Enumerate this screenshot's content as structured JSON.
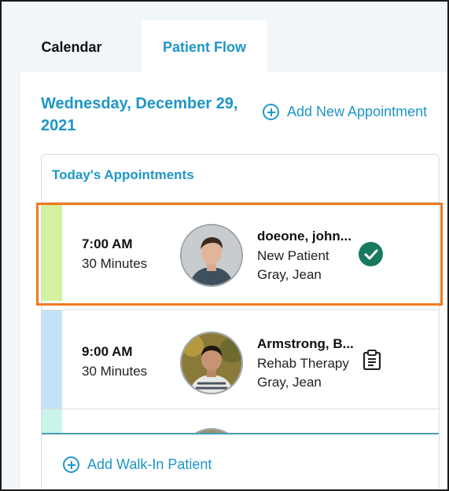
{
  "tabs": [
    {
      "label": "Calendar"
    },
    {
      "label": "Patient Flow",
      "active": true
    }
  ],
  "date_title": "Wednesday, December 29, 2021",
  "add_appointment_label": "Add New Appointment",
  "card_title": "Today's Appointments",
  "appointments": [
    {
      "time": "7:00 AM",
      "duration": "30 Minutes",
      "patient_name": "doeone, john...",
      "visit_type": "New Patient",
      "provider": "Gray, Jean",
      "status_icon": "check-circle-icon",
      "stripe_color": "#d4f0a0",
      "highlighted": true
    },
    {
      "time": "9:00 AM",
      "duration": "30 Minutes",
      "patient_name": "Armstrong, B...",
      "visit_type": "Rehab Therapy",
      "provider": "Gray, Jean",
      "status_icon": "clipboard-icon",
      "stripe_color": "#c4e2f8"
    },
    {
      "stripe_color": "#c9f4e9"
    }
  ],
  "add_walkin_label": "Add Walk-In Patient",
  "colors": {
    "accent": "#1e96c8",
    "check": "#17795f",
    "highlight": "#f07a1e"
  }
}
